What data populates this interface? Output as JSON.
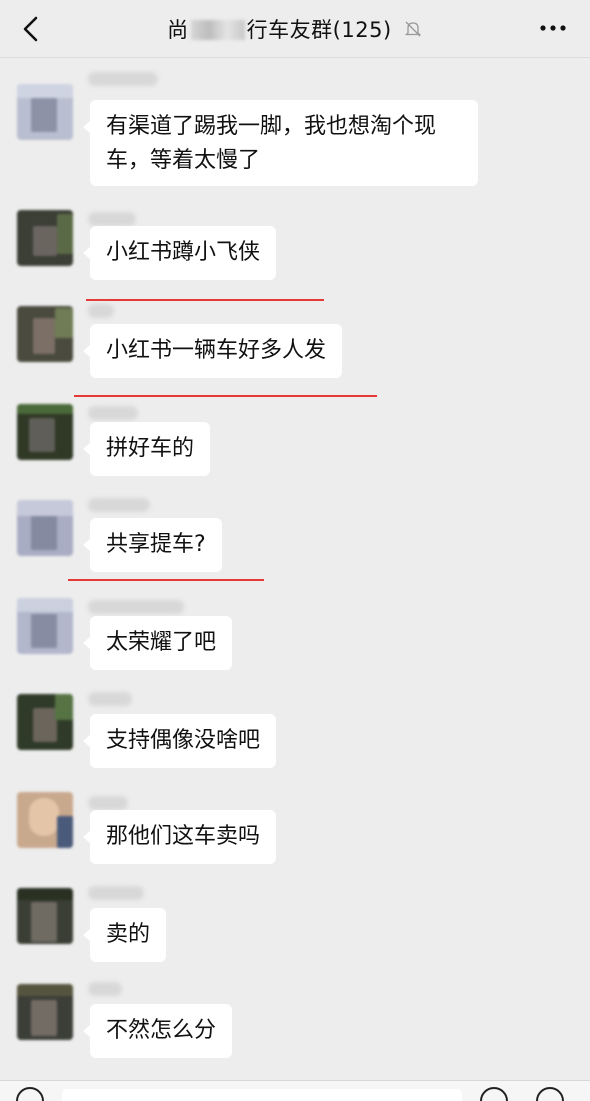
{
  "header": {
    "title_prefix": "尚",
    "title_suffix": "行车友群(125)",
    "back_icon": "chevron-left-icon",
    "mute_icon": "bell-off-icon",
    "more_icon": "more-horizontal-icon"
  },
  "messages": [
    {
      "text_line1": "有渠道了踢我一脚，我也想淘个现",
      "text_line2": "车，等着太慢了"
    },
    {
      "text": "小红书蹲小飞侠"
    },
    {
      "text": "小红书一辆车好多人发"
    },
    {
      "text": "拼好车的"
    },
    {
      "text": "共享提车?"
    },
    {
      "text": "太荣耀了吧"
    },
    {
      "text": "支持偶像没啥吧"
    },
    {
      "text": "那他们这车卖吗"
    },
    {
      "text": "卖的"
    },
    {
      "text": "不然怎么分"
    }
  ],
  "colors": {
    "background": "#ededed",
    "bubble": "#ffffff",
    "annotation_underline": "#e53935"
  }
}
